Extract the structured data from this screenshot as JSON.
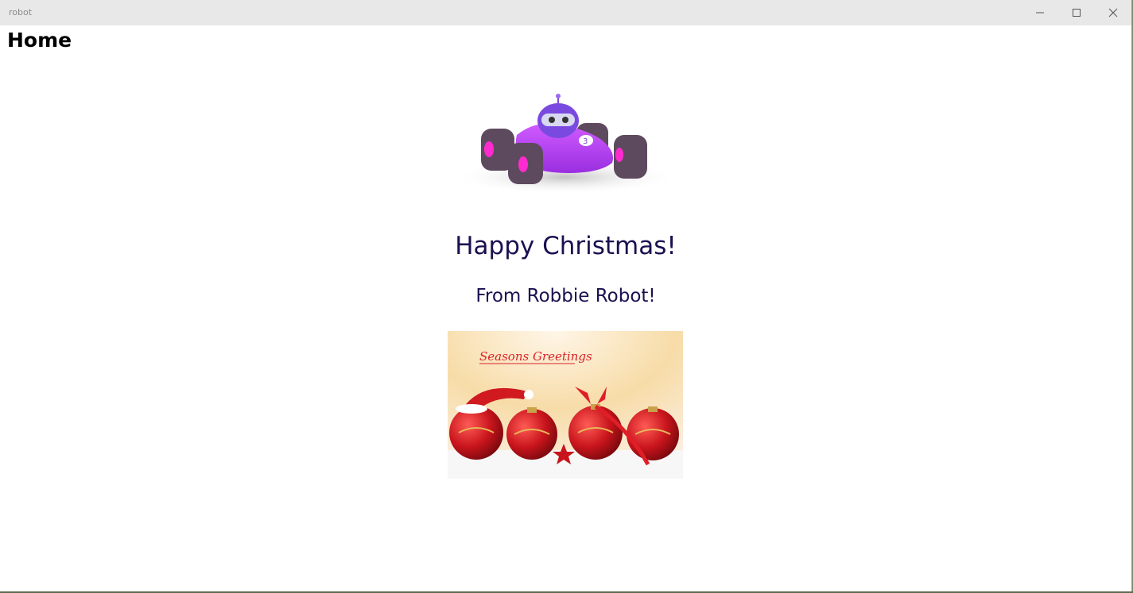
{
  "window": {
    "title": "robot",
    "controls": {
      "minimize_icon": "minimize-icon",
      "maximize_icon": "maximize-icon",
      "close_icon": "close-icon"
    }
  },
  "page": {
    "heading": "Home",
    "greeting": "Happy Christmas!",
    "sub_greeting": "From Robbie Robot!",
    "card_caption": "Seasons Greetings"
  },
  "colors": {
    "greeting_text": "#1b1050",
    "titlebar": "#e8e8e8",
    "robot_car": "#b23cf0",
    "ornament_red": "#c8141c"
  }
}
